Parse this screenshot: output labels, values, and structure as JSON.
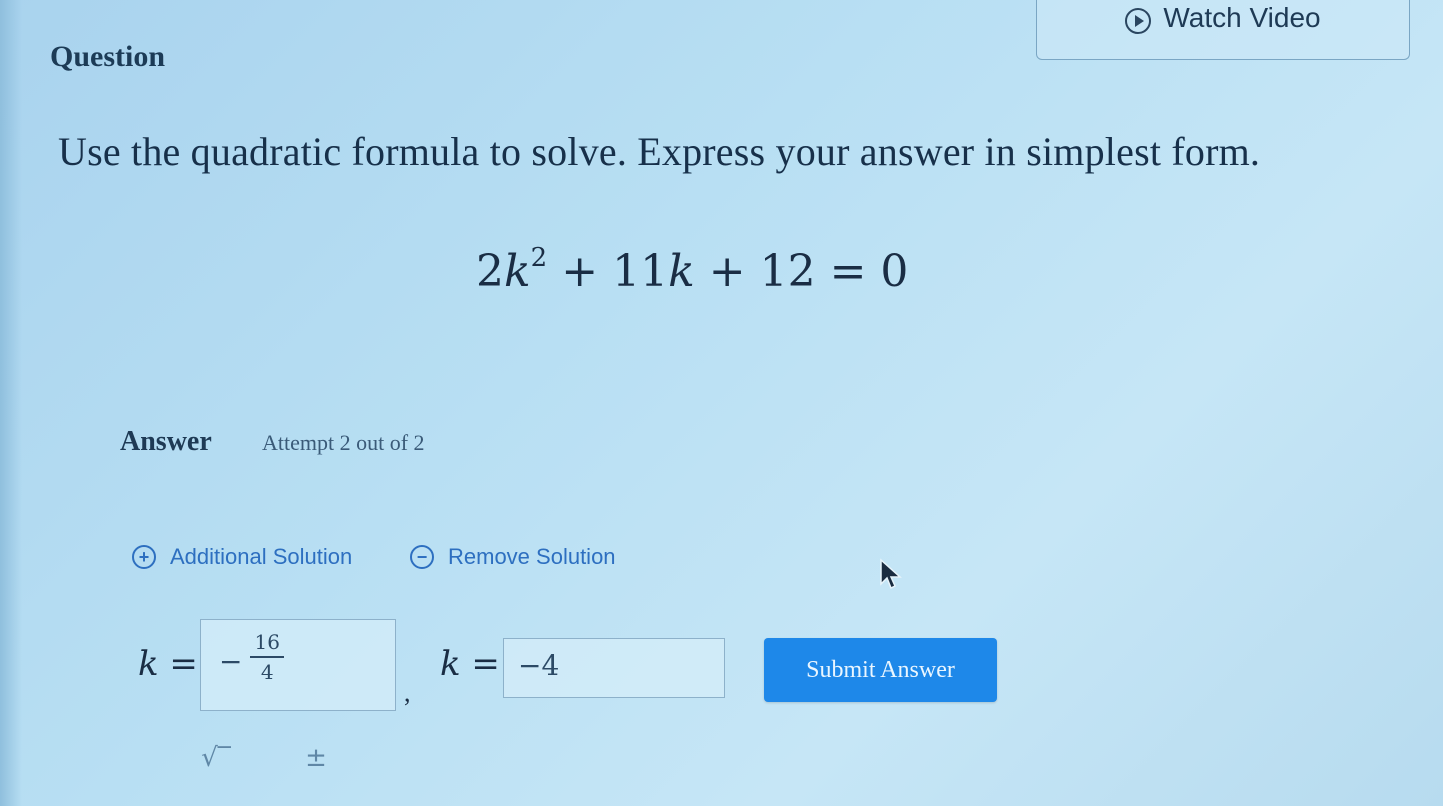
{
  "header": {
    "question_label": "Question",
    "watch_video_label": "Watch Video"
  },
  "prompt": "Use the quadratic formula to solve. Express your answer in simplest form.",
  "equation": {
    "coef_a": "2",
    "variable": "k",
    "exponent": "2",
    "middle": "+ 11",
    "end": "+ 12 = 0"
  },
  "answer": {
    "label": "Answer",
    "attempt": "Attempt 2 out of 2"
  },
  "solutions": {
    "add_label": "Additional Solution",
    "remove_label": "Remove Solution",
    "equals": "=",
    "first": {
      "minus": "−",
      "numerator": "16",
      "denominator": "4"
    },
    "separator": ",",
    "second_value": "−4"
  },
  "submit_label": "Submit Answer",
  "toolbar": {
    "sqrt_symbol": "√‾",
    "plusminus_symbol": "±"
  }
}
